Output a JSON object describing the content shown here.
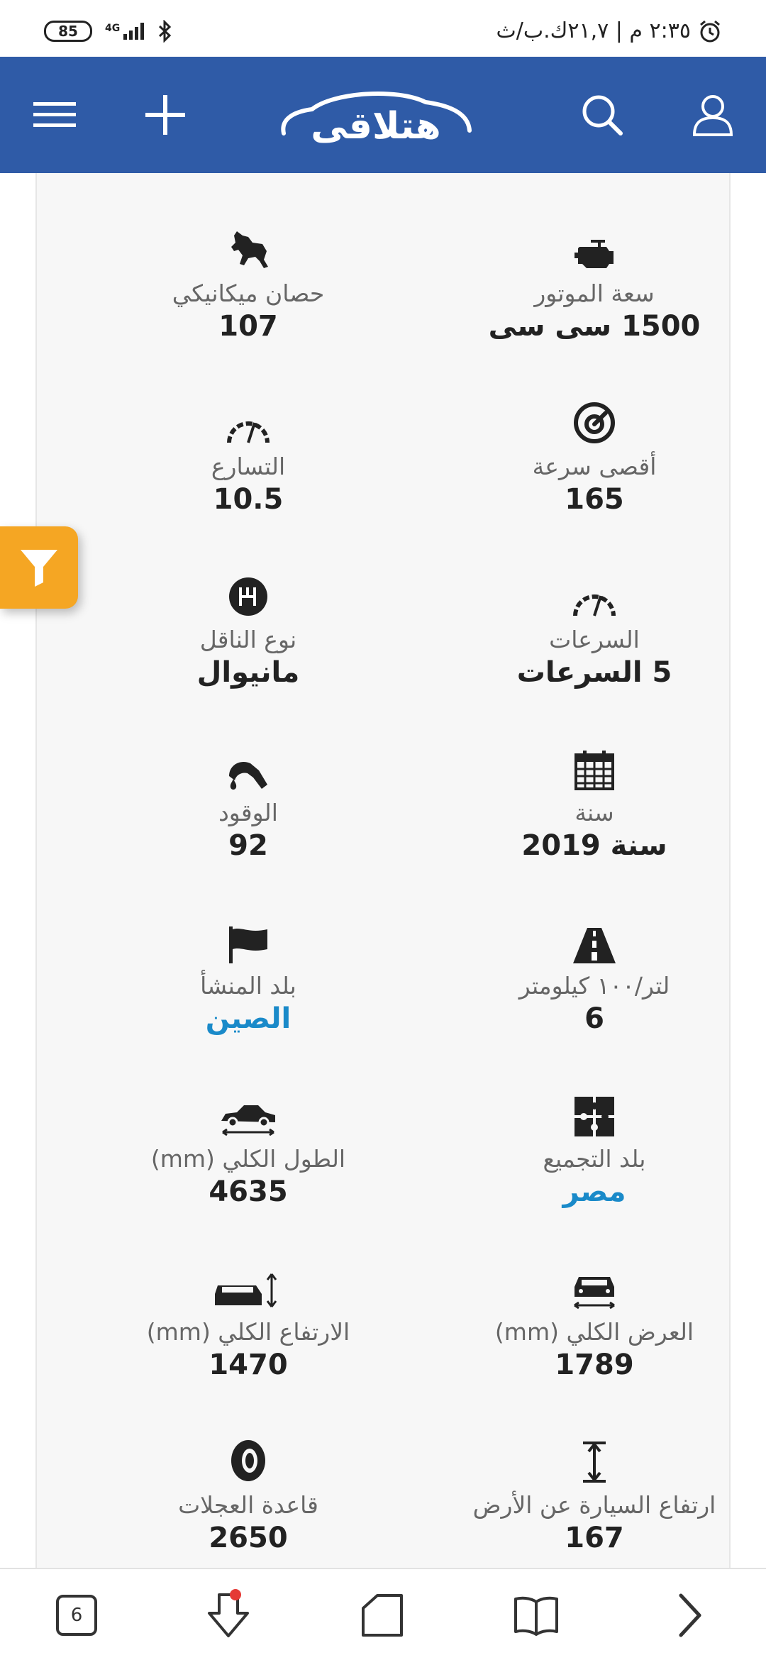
{
  "status_bar": {
    "battery": "85",
    "network": "4G",
    "time_text": "٢:٣٥ م | ٢١,٧ك.ب/ث"
  },
  "header": {
    "logo_text": "هتلاقى",
    "background_color": "#2f5ba7"
  },
  "specs": [
    {
      "icon": "engine-icon",
      "label": "سعة الموتور",
      "value": "1500 سى سى",
      "link": false
    },
    {
      "icon": "horse-icon",
      "label": "حصان ميكانيكي",
      "value": "107",
      "link": false
    },
    {
      "icon": "max-speed-icon",
      "label": "أقصى سرعة",
      "value": "165",
      "link": false
    },
    {
      "icon": "speedometer-icon",
      "label": "التسارع",
      "value": "10.5",
      "link": false
    },
    {
      "icon": "speedometer-icon",
      "label": "السرعات",
      "value": "5 السرعات",
      "link": false
    },
    {
      "icon": "gearbox-icon",
      "label": "نوع الناقل",
      "value": "مانيوال",
      "link": false
    },
    {
      "icon": "calendar-icon",
      "label": "سنة",
      "value": "سنة 2019",
      "link": false
    },
    {
      "icon": "fuel-pump-icon",
      "label": "الوقود",
      "value": "92",
      "link": false
    },
    {
      "icon": "road-icon",
      "label": "لتر/١٠٠ كيلومتر",
      "value": "6",
      "link": false
    },
    {
      "icon": "flag-icon",
      "label": "بلد المنشأ",
      "value": "الصين",
      "link": true
    },
    {
      "icon": "puzzle-icon",
      "label": "بلد التجميع",
      "value": "مصر",
      "link": true
    },
    {
      "icon": "car-length-icon",
      "label": "الطول الكلي (mm)",
      "value": "4635",
      "link": false
    },
    {
      "icon": "car-width-icon",
      "label": "العرض الكلي (mm)",
      "value": "1789",
      "link": false
    },
    {
      "icon": "car-height-icon",
      "label": "الارتفاع الكلي (mm)",
      "value": "1470",
      "link": false
    },
    {
      "icon": "ground-clearance-icon",
      "label": "ارتفاع السيارة عن الأرض",
      "value": "167",
      "link": false
    },
    {
      "icon": "tire-icon",
      "label": "قاعدة العجلات",
      "value": "2650",
      "link": false
    }
  ],
  "bottom_nav": {
    "tabs_count": "6"
  },
  "colors": {
    "accent": "#f5a623",
    "link": "#1a8ac9"
  }
}
